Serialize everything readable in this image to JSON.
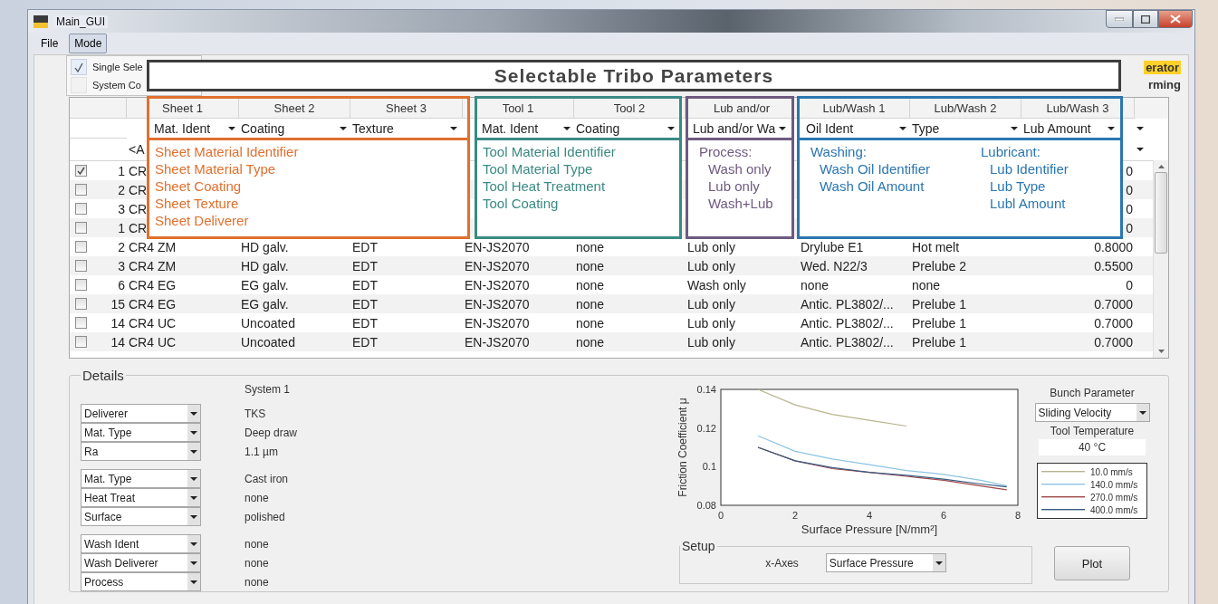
{
  "window": {
    "title": "Main_GUI"
  },
  "menu": [
    {
      "label": "File",
      "selected": false
    },
    {
      "label": "Mode",
      "selected": true
    }
  ],
  "mode_menu": [
    {
      "label": "Single Sele",
      "checked": true
    },
    {
      "label": "System Co",
      "checked": false
    }
  ],
  "logo": [
    "erator",
    "rming"
  ],
  "table": {
    "group_headers": [
      "Sheet 1",
      "Sheet 2",
      "Sheet 3",
      "Tool 1",
      "Tool 2",
      "Lub and/or",
      "Lub/Wash 1",
      "Lub/Wash 2",
      "Lub/Wash 3"
    ],
    "column_filters": [
      "Mat. Ident",
      "Coating",
      "Texture",
      "Mat. Ident",
      "Coating",
      "Lub and/or Wa",
      "Oil Ident",
      "Type",
      "Lub Amount"
    ],
    "filter_value": "<A",
    "rows": [
      {
        "checked": true,
        "no": "1",
        "sheet_ident": "CR",
        "lub_amount": "0"
      },
      {
        "checked": false,
        "no": "2",
        "sheet_ident": "CR",
        "lub_amount": "0"
      },
      {
        "checked": false,
        "no": "3",
        "sheet_ident": "CR",
        "lub_amount": "0"
      },
      {
        "checked": false,
        "no": "1",
        "sheet_ident": "CR",
        "lub_amount": "0"
      },
      {
        "checked": false,
        "no": "2",
        "sheet_ident": "CR4 ZM",
        "sheet_coating": "HD galv.",
        "sheet_texture": "EDT",
        "tool_ident": "EN-JS2070",
        "tool_coating": "none",
        "process": "Lub only",
        "oil_ident": "Drylube E1",
        "lub_type": "Hot melt",
        "lub_amount": "0.8000"
      },
      {
        "checked": false,
        "no": "3",
        "sheet_ident": "CR4 ZM",
        "sheet_coating": "HD galv.",
        "sheet_texture": "EDT",
        "tool_ident": "EN-JS2070",
        "tool_coating": "none",
        "process": "Lub only",
        "oil_ident": "Wed. N22/3",
        "lub_type": "Prelube 2",
        "lub_amount": "0.5500"
      },
      {
        "checked": false,
        "no": "6",
        "sheet_ident": "CR4 EG",
        "sheet_coating": "EG galv.",
        "sheet_texture": "EDT",
        "tool_ident": "EN-JS2070",
        "tool_coating": "none",
        "process": "Wash only",
        "oil_ident": "none",
        "lub_type": "none",
        "lub_amount": "0"
      },
      {
        "checked": false,
        "no": "15",
        "sheet_ident": "CR4 EG",
        "sheet_coating": "EG galv.",
        "sheet_texture": "EDT",
        "tool_ident": "EN-JS2070",
        "tool_coating": "none",
        "process": "Lub only",
        "oil_ident": "Antic. PL3802/...",
        "lub_type": "Prelube 1",
        "lub_amount": "0.7000"
      },
      {
        "checked": false,
        "no": "14",
        "sheet_ident": "CR4 UC",
        "sheet_coating": "Uncoated",
        "sheet_texture": "EDT",
        "tool_ident": "EN-JS2070",
        "tool_coating": "none",
        "process": "Lub only",
        "oil_ident": "Antic. PL3802/...",
        "lub_type": "Prelube 1",
        "lub_amount": "0.7000"
      },
      {
        "checked": false,
        "no": "14",
        "sheet_ident": "CR4 UC",
        "sheet_coating": "Uncoated",
        "sheet_texture": "EDT",
        "tool_ident": "EN-JS2070",
        "tool_coating": "none",
        "process": "Lub only",
        "oil_ident": "Antic. PL3802/...",
        "lub_type": "Prelube 1",
        "lub_amount": "0.7000"
      }
    ]
  },
  "annotations": {
    "title": "Selectable Tribo Parameters",
    "boxes": [
      {
        "kind": "list",
        "color": "#e0702e",
        "lines": [
          "Sheet Material Identifier",
          "Sheet Material Type",
          "Sheet Coating",
          "Sheet Texture",
          "Sheet Deliverer"
        ]
      },
      {
        "kind": "list",
        "color": "#3a8a84",
        "lines": [
          "Tool Material Identifier",
          "Tool Material Type",
          "Tool Heat Treatment",
          "Tool Coating"
        ]
      },
      {
        "kind": "grouped",
        "color": "#6e5a80",
        "groups": [
          {
            "heading": "Process:",
            "items": [
              "Wash only",
              "Lub only",
              "Wash+Lub"
            ]
          }
        ]
      },
      {
        "kind": "grouped",
        "color": "#2a76b0",
        "groups": [
          {
            "heading": "Washing:",
            "items": [
              "Wash Oil Identifier",
              "Wash Oil Amount"
            ]
          },
          {
            "heading": "Lubricant:",
            "items": [
              "Lub Identifier",
              "Lub Type",
              "Lubl Amount"
            ]
          }
        ]
      }
    ]
  },
  "details": {
    "title": "Details",
    "system": "System 1",
    "groups": [
      [
        {
          "field": "Deliverer",
          "value": "TKS"
        },
        {
          "field": "Mat. Type",
          "value": "Deep draw"
        },
        {
          "field": "Ra",
          "value": "1.1 µm"
        }
      ],
      [
        {
          "field": "Mat. Type",
          "value": "Cast iron"
        },
        {
          "field": "Heat Treat",
          "value": "none"
        },
        {
          "field": "Surface",
          "value": "polished"
        }
      ],
      [
        {
          "field": "Wash Ident",
          "value": "none"
        },
        {
          "field": "Wash Deliverer",
          "value": "none"
        },
        {
          "field": "Process",
          "value": "none"
        }
      ]
    ]
  },
  "chart": {
    "chart_data": {
      "type": "line",
      "xlabel": "Surface Pressure [N/mm²]",
      "ylabel": "Friction Coefficient μ",
      "x": [
        1,
        2,
        3,
        4,
        5,
        6,
        7,
        7.7
      ],
      "series": [
        {
          "name": "10.0 mm/s",
          "color": "#b8b48c",
          "values": [
            0.14,
            0.132,
            0.127,
            0.124,
            0.121,
            null,
            null,
            null
          ]
        },
        {
          "name": "140.0 mm/s",
          "color": "#8cc4e4",
          "values": [
            0.116,
            0.108,
            0.104,
            0.101,
            0.098,
            0.096,
            0.093,
            0.09
          ]
        },
        {
          "name": "270.0 mm/s",
          "color": "#a04848",
          "values": [
            0.11,
            0.103,
            0.099,
            0.097,
            0.095,
            0.093,
            0.09,
            0.088
          ]
        },
        {
          "name": "400.0 mm/s",
          "color": "#3a5a80",
          "values": [
            0.11,
            0.103,
            0.0995,
            0.097,
            0.0955,
            0.0935,
            0.091,
            0.0895
          ]
        }
      ],
      "xlim": [
        0,
        8
      ],
      "ylim": [
        0.08,
        0.14
      ],
      "xticks": [
        0,
        2,
        4,
        6,
        8
      ],
      "yticks": [
        {
          "value": 0.08,
          "label": "0.08"
        },
        {
          "value": 0.1,
          "label": "0.1"
        },
        {
          "value": 0.12,
          "label": "0.12"
        },
        {
          "value": 0.14,
          "label": "0.14"
        }
      ]
    }
  },
  "bunch": {
    "label": "Bunch Parameter",
    "value": "Sliding Velocity"
  },
  "tool_temperature": {
    "label": "Tool Temperature",
    "value": "40 °C"
  },
  "setup": {
    "title": "Setup",
    "label": "x-Axes",
    "value": "Surface Pressure"
  },
  "plot_button": "Plot"
}
